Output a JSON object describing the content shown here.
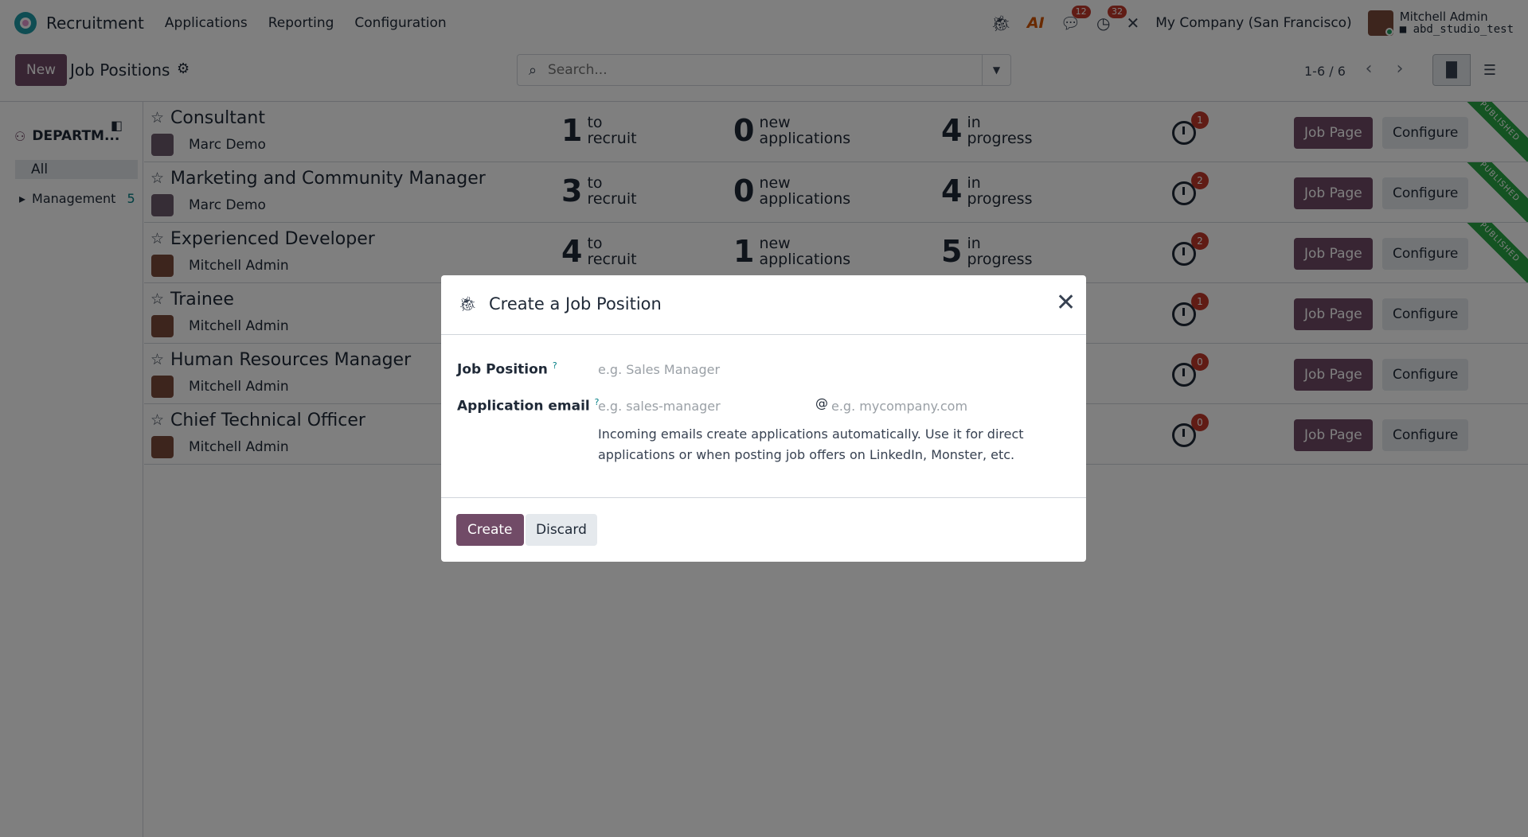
{
  "navbar": {
    "app_name": "Recruitment",
    "menus": [
      "Applications",
      "Reporting",
      "Configuration"
    ],
    "chat_count": "12",
    "activity_count": "32",
    "company": "My Company (San Francisco)",
    "user_name": "Mitchell Admin",
    "database": "abd_studio_test",
    "ai_label": "AI"
  },
  "control": {
    "new_label": "New",
    "title": "Job Positions",
    "search_placeholder": "Search...",
    "pager": "1-6 / 6"
  },
  "sidebar": {
    "header": "DEPARTM...",
    "all_label": "All",
    "items": [
      {
        "label": "Management",
        "count": "5"
      }
    ]
  },
  "rows": [
    {
      "name": "Consultant",
      "owner": "Marc Demo",
      "to_recruit": "1",
      "new_apps": "0",
      "in_progress": "4",
      "activities": "1",
      "published": true
    },
    {
      "name": "Marketing and Community Manager",
      "owner": "Marc Demo",
      "to_recruit": "3",
      "new_apps": "0",
      "in_progress": "4",
      "activities": "2",
      "published": true
    },
    {
      "name": "Experienced Developer",
      "owner": "Mitchell Admin",
      "to_recruit": "4",
      "new_apps": "1",
      "in_progress": "5",
      "activities": "2",
      "published": true
    },
    {
      "name": "Trainee",
      "owner": "Mitchell Admin",
      "to_recruit": "",
      "new_apps": "",
      "in_progress": "",
      "activities": "1",
      "published": false
    },
    {
      "name": "Human Resources Manager",
      "owner": "Mitchell Admin",
      "to_recruit": "",
      "new_apps": "",
      "in_progress": "",
      "activities": "0",
      "published": false
    },
    {
      "name": "Chief Technical Officer",
      "owner": "Mitchell Admin",
      "to_recruit": "",
      "new_apps": "",
      "in_progress": "",
      "activities": "0",
      "published": false
    }
  ],
  "stat_labels": {
    "to_recruit": "to\nrecruit",
    "new_apps": "new\napplications",
    "in_progress": "in\nprogress"
  },
  "row_buttons": {
    "job_page": "Job Page",
    "configure": "Configure"
  },
  "ribbon_text": "PUBLISHED",
  "modal": {
    "title": "Create a Job Position",
    "job_position_label": "Job Position",
    "job_position_placeholder": "e.g. Sales Manager",
    "email_label": "Application email",
    "email_alias_placeholder": "e.g. sales-manager",
    "email_at": "@",
    "email_domain_placeholder": "e.g. mycompany.com",
    "help_text": "Incoming emails create applications automatically. Use it for direct applications or when posting job offers on LinkedIn, Monster, etc.",
    "tooltip_mark": "?",
    "create_label": "Create",
    "discard_label": "Discard"
  },
  "colors": {
    "brand": "#714b67",
    "accent": "#017e84",
    "badge": "#c0392b",
    "ribbon": "#28a745"
  },
  "icons": [
    "logo-icon",
    "bug-icon",
    "ai-icon",
    "chat-icon",
    "clock-icon",
    "tools-icon",
    "gear-icon",
    "search-icon",
    "chevron-down-icon",
    "chevron-left-icon",
    "chevron-right-icon",
    "kanban-view-icon",
    "list-view-icon",
    "department-icon",
    "sidebar-collapse-icon",
    "star-icon",
    "close-icon"
  ]
}
